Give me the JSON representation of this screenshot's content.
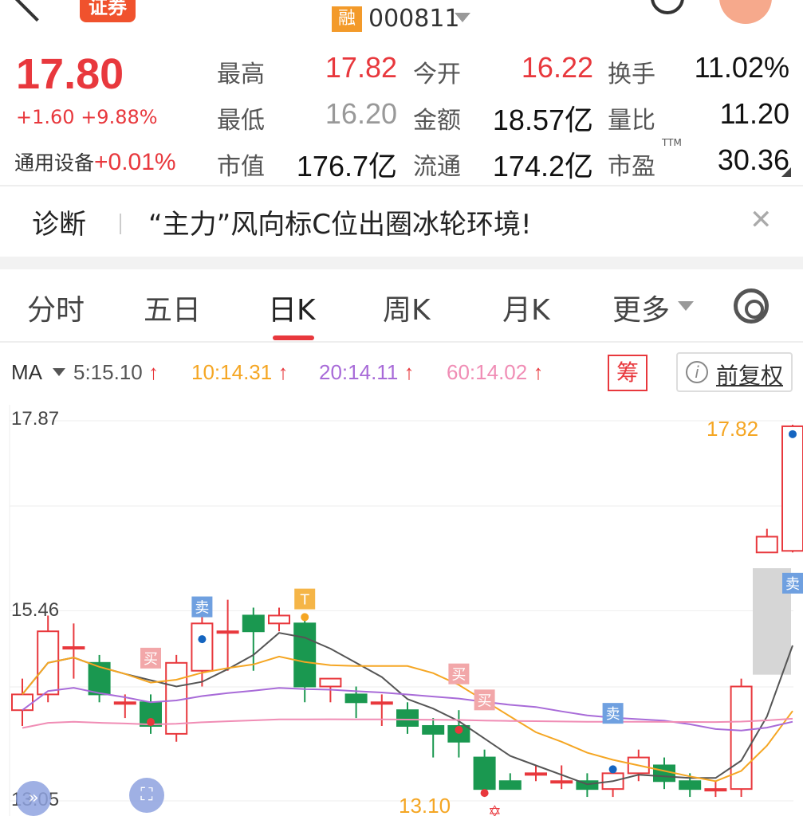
{
  "header": {
    "broker_badge": "证券",
    "margin_badge": "融",
    "stock_code": "000811"
  },
  "quote": {
    "price": "17.80",
    "change": "+1.60",
    "change_pct": "+9.88%",
    "industry": "通用设备",
    "industry_chg": "+0.01%",
    "fields": [
      {
        "label": "最高",
        "value": "17.82",
        "color": "red"
      },
      {
        "label": "今开",
        "value": "16.22",
        "color": "red"
      },
      {
        "label": "换手",
        "value": "11.02%",
        "color": "blk"
      },
      {
        "label": "最低",
        "value": "16.20",
        "color": "gray"
      },
      {
        "label": "金额",
        "value": "18.57亿",
        "color": "blk"
      },
      {
        "label": "量比",
        "value": "11.20",
        "color": "blk"
      },
      {
        "label": "市值",
        "value": "176.7亿",
        "color": "blk"
      },
      {
        "label": "流通",
        "value": "174.2亿",
        "color": "blk"
      },
      {
        "label": "市盈",
        "value": "30.36",
        "color": "blk"
      }
    ],
    "pe_suffix": "TTM"
  },
  "diagnosis": {
    "label": "诊断",
    "text": "“主力”风向标C位出圈冰轮环境!"
  },
  "tabs": [
    "分时",
    "五日",
    "日K",
    "周K",
    "月K",
    "更多"
  ],
  "active_tab": "日K",
  "ma": {
    "label": "MA",
    "ma5": "5:15.10",
    "ma10": "10:14.31",
    "ma20": "20:14.11",
    "ma60": "60:14.02",
    "up_arrow": "↑"
  },
  "chips_button": "筹",
  "adjust_button": "前复权",
  "adjust_icon": "i",
  "colors": {
    "up": "#e8383d",
    "down": "#1a9850",
    "ma5": "#555555",
    "ma10": "#f5a623",
    "ma20": "#a86bd8",
    "ma60": "#f08db5"
  },
  "chart_data": {
    "type": "candlestick",
    "y_labels": [
      "17.87",
      "15.46",
      "13.05"
    ],
    "high_label": "17.82",
    "low_label": "13.10",
    "markers": {
      "buy": "买",
      "sell": "卖",
      "t": "T"
    },
    "candles": [
      {
        "o": 14.2,
        "c": 14.4,
        "h": 14.6,
        "l": 14.0
      },
      {
        "o": 14.4,
        "c": 15.2,
        "h": 15.4,
        "l": 14.3
      },
      {
        "o": 15.0,
        "c": 15.0,
        "h": 15.3,
        "l": 14.6
      },
      {
        "o": 14.8,
        "c": 14.4,
        "h": 14.9,
        "l": 14.3
      },
      {
        "o": 14.3,
        "c": 14.3,
        "h": 14.4,
        "l": 14.1
      },
      {
        "o": 14.3,
        "c": 14.0,
        "h": 14.4,
        "l": 13.9
      },
      {
        "o": 13.9,
        "c": 14.8,
        "h": 14.9,
        "l": 13.8
      },
      {
        "o": 14.7,
        "c": 15.3,
        "h": 15.5,
        "l": 14.5
      },
      {
        "o": 15.2,
        "c": 15.2,
        "h": 15.6,
        "l": 14.7
      },
      {
        "o": 15.4,
        "c": 15.2,
        "h": 15.5,
        "l": 14.7
      },
      {
        "o": 15.3,
        "c": 15.4,
        "h": 15.5,
        "l": 15.2
      },
      {
        "o": 15.3,
        "c": 14.5,
        "h": 15.4,
        "l": 14.3
      },
      {
        "o": 14.5,
        "c": 14.6,
        "h": 14.6,
        "l": 14.3
      },
      {
        "o": 14.4,
        "c": 14.3,
        "h": 14.5,
        "l": 14.1
      },
      {
        "o": 14.3,
        "c": 14.3,
        "h": 14.4,
        "l": 14.0
      },
      {
        "o": 14.2,
        "c": 14.0,
        "h": 14.3,
        "l": 13.9
      },
      {
        "o": 14.0,
        "c": 13.9,
        "h": 14.1,
        "l": 13.6
      },
      {
        "o": 14.0,
        "c": 13.8,
        "h": 14.2,
        "l": 13.6
      },
      {
        "o": 13.6,
        "c": 13.2,
        "h": 13.7,
        "l": 13.1
      },
      {
        "o": 13.3,
        "c": 13.2,
        "h": 13.4,
        "l": 13.2
      },
      {
        "o": 13.4,
        "c": 13.4,
        "h": 13.5,
        "l": 13.3
      },
      {
        "o": 13.3,
        "c": 13.3,
        "h": 13.5,
        "l": 13.2
      },
      {
        "o": 13.3,
        "c": 13.2,
        "h": 13.4,
        "l": 13.1
      },
      {
        "o": 13.2,
        "c": 13.4,
        "h": 13.5,
        "l": 13.1
      },
      {
        "o": 13.4,
        "c": 13.6,
        "h": 13.7,
        "l": 13.3
      },
      {
        "o": 13.5,
        "c": 13.3,
        "h": 13.6,
        "l": 13.2
      },
      {
        "o": 13.3,
        "c": 13.2,
        "h": 13.4,
        "l": 13.1
      },
      {
        "o": 13.2,
        "c": 13.2,
        "h": 13.3,
        "l": 13.1
      },
      {
        "o": 13.2,
        "c": 14.5,
        "h": 14.6,
        "l": 13.1
      },
      {
        "o": 16.2,
        "c": 16.4,
        "h": 16.5,
        "l": 16.2
      },
      {
        "o": 16.22,
        "c": 17.8,
        "h": 17.82,
        "l": 16.2
      }
    ]
  }
}
